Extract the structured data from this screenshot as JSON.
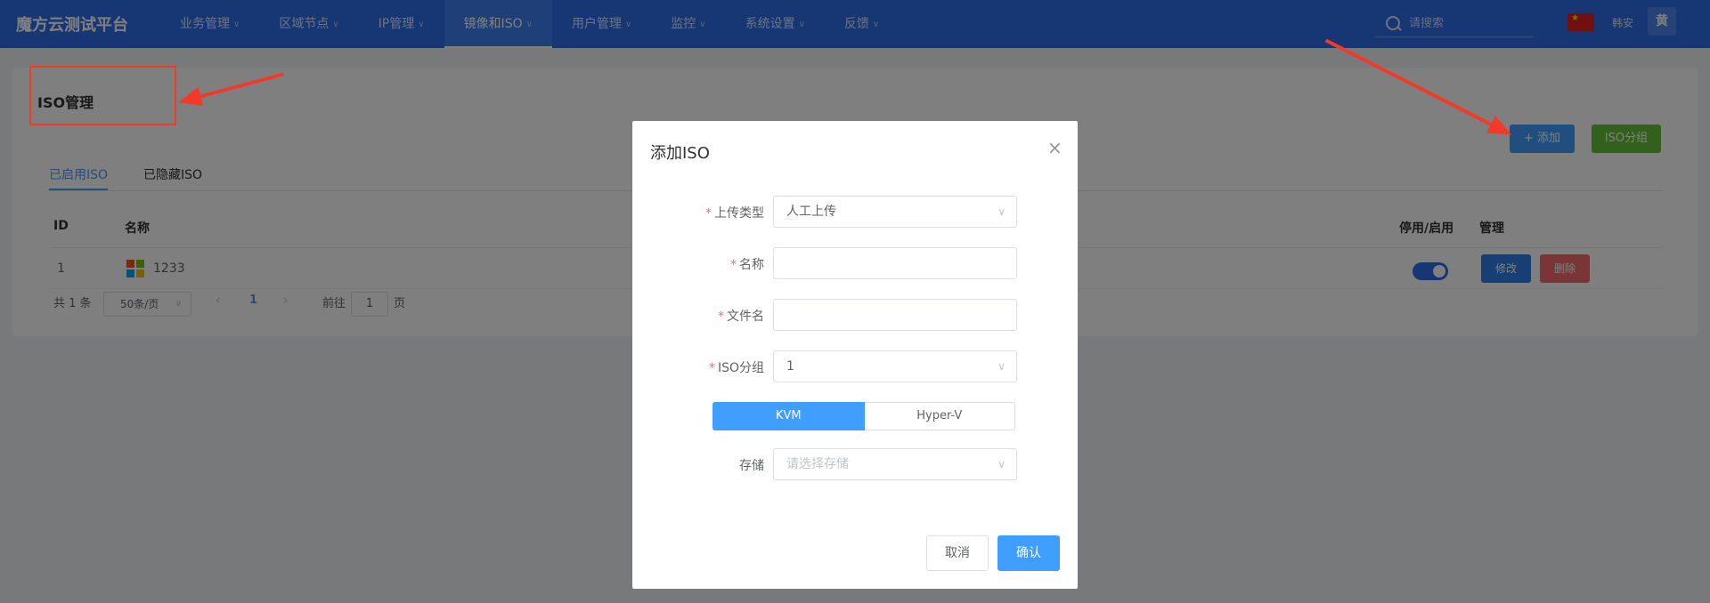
{
  "app": {
    "brand": "魔方云测试平台"
  },
  "nav": {
    "items": [
      {
        "label": "业务管理"
      },
      {
        "label": "区域节点"
      },
      {
        "label": "IP管理"
      },
      {
        "label": "镜像和ISO"
      },
      {
        "label": "用户管理"
      },
      {
        "label": "监控"
      },
      {
        "label": "系统设置"
      },
      {
        "label": "反馈"
      }
    ],
    "active": "镜像和ISO"
  },
  "header": {
    "search_placeholder": "请搜索",
    "user_name": "韩安",
    "avatar_text": "黄"
  },
  "page": {
    "title": "ISO管理",
    "add_button": "+ 添加",
    "group_button": "ISO分组",
    "tabs": [
      {
        "label": "已启用ISO",
        "active": true
      },
      {
        "label": "已隐藏ISO",
        "active": false
      }
    ]
  },
  "table": {
    "columns": {
      "id": "ID",
      "name": "名称",
      "toggle": "停用/启用",
      "manage": "管理"
    },
    "rows": [
      {
        "id": "1",
        "name": "1233",
        "enabled": true,
        "edit": "修改",
        "delete": "删除"
      }
    ]
  },
  "pagination": {
    "total": "共 1 条",
    "page_size": "50条/页",
    "current": "1",
    "goto_prefix": "前往",
    "goto_value": "1",
    "goto_suffix": "页"
  },
  "modal": {
    "title": "添加ISO",
    "fields": {
      "upload_type": {
        "label": "上传类型",
        "value": "人工上传"
      },
      "name": {
        "label": "名称",
        "value": ""
      },
      "filename": {
        "label": "文件名",
        "value": ""
      },
      "iso_group": {
        "label": "ISO分组",
        "value": "1"
      },
      "storage": {
        "label": "存储",
        "placeholder": "请选择存储"
      }
    },
    "hypervisor": {
      "options": [
        "KVM",
        "Hyper-V"
      ],
      "selected": "KVM"
    },
    "cancel": "取消",
    "confirm": "确认"
  },
  "colors": {
    "nav_bg": "#2f6fe8",
    "primary": "#409eff",
    "success": "#67c23a",
    "danger": "#f56c6c",
    "annotation": "#f23a2b"
  }
}
